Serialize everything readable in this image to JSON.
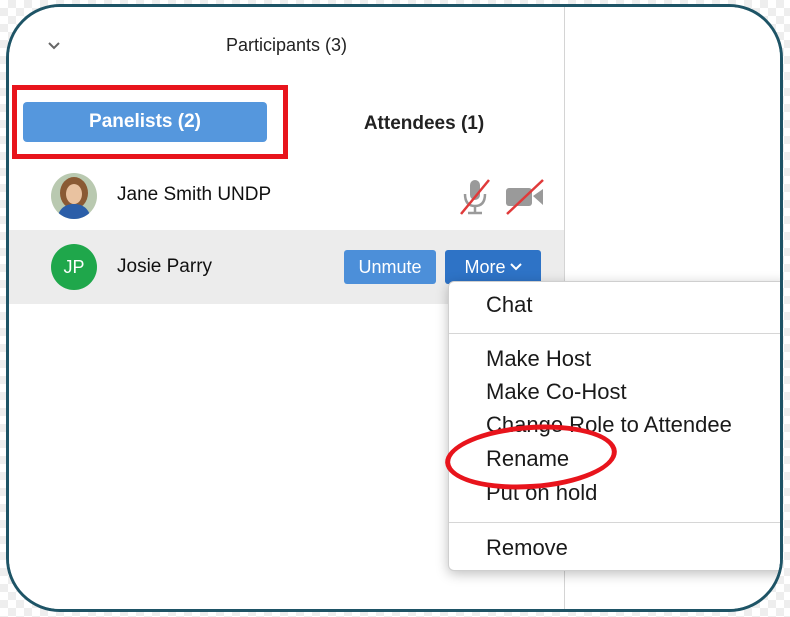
{
  "header": {
    "title": "Participants (3)",
    "collapse_icon": "chevron-down-icon"
  },
  "tabs": [
    {
      "label": "Panelists (2)",
      "selected": true
    },
    {
      "label": "Attendees (1)",
      "selected": false
    }
  ],
  "participants": [
    {
      "name": "Jane Smith UNDP",
      "avatar": "photo",
      "mic": "muted",
      "video": "off"
    },
    {
      "name": "Josie Parry",
      "initials": "JP",
      "avatar_color": "#1fa74b",
      "unmute_label": "Unmute",
      "more_label": "More"
    }
  ],
  "menu": {
    "items": [
      "Chat",
      "Make Host",
      "Make Co-Host",
      "Change Role to Attendee",
      "Rename",
      "Put on hold",
      "Remove"
    ]
  },
  "colors": {
    "accent": "#5597dd",
    "more_button": "#2e73c6",
    "annotation_red": "#e8141c",
    "frame": "#1e5466"
  }
}
